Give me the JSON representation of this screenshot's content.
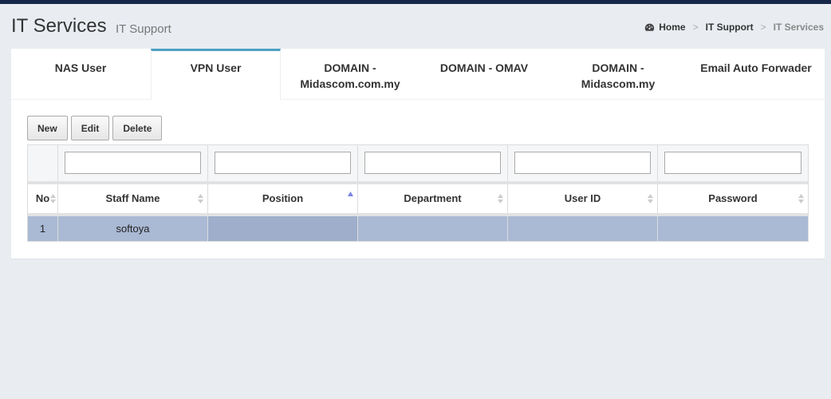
{
  "header": {
    "title": "IT Services",
    "subtitle": "IT Support"
  },
  "breadcrumb": {
    "home": "Home",
    "separator": ">",
    "section": "IT Support",
    "current": "IT Services"
  },
  "tabs": [
    {
      "label": "NAS User",
      "active": false
    },
    {
      "label": "VPN User",
      "active": true
    },
    {
      "label": "DOMAIN - Midascom.com.my",
      "active": false
    },
    {
      "label": "DOMAIN - OMAV",
      "active": false
    },
    {
      "label": "DOMAIN - Midascom.my",
      "active": false
    },
    {
      "label": "Email Auto Forwader",
      "active": false
    }
  ],
  "toolbar": {
    "new_label": "New",
    "edit_label": "Edit",
    "delete_label": "Delete"
  },
  "grid": {
    "columns": [
      "No",
      "Staff Name",
      "Position",
      "Department",
      "User ID",
      "Password"
    ],
    "sorted_column": "Position",
    "sort_direction": "ascending",
    "rows": [
      {
        "no": "1",
        "staff_name": "softoya",
        "position": "",
        "department": "",
        "user_id": "",
        "password": ""
      }
    ],
    "selected_row_color": "#aab9d4"
  },
  "colors": {
    "topbar": "#17274a",
    "active_tab_accent": "#4e9fc2",
    "background": "#e9edf2"
  }
}
